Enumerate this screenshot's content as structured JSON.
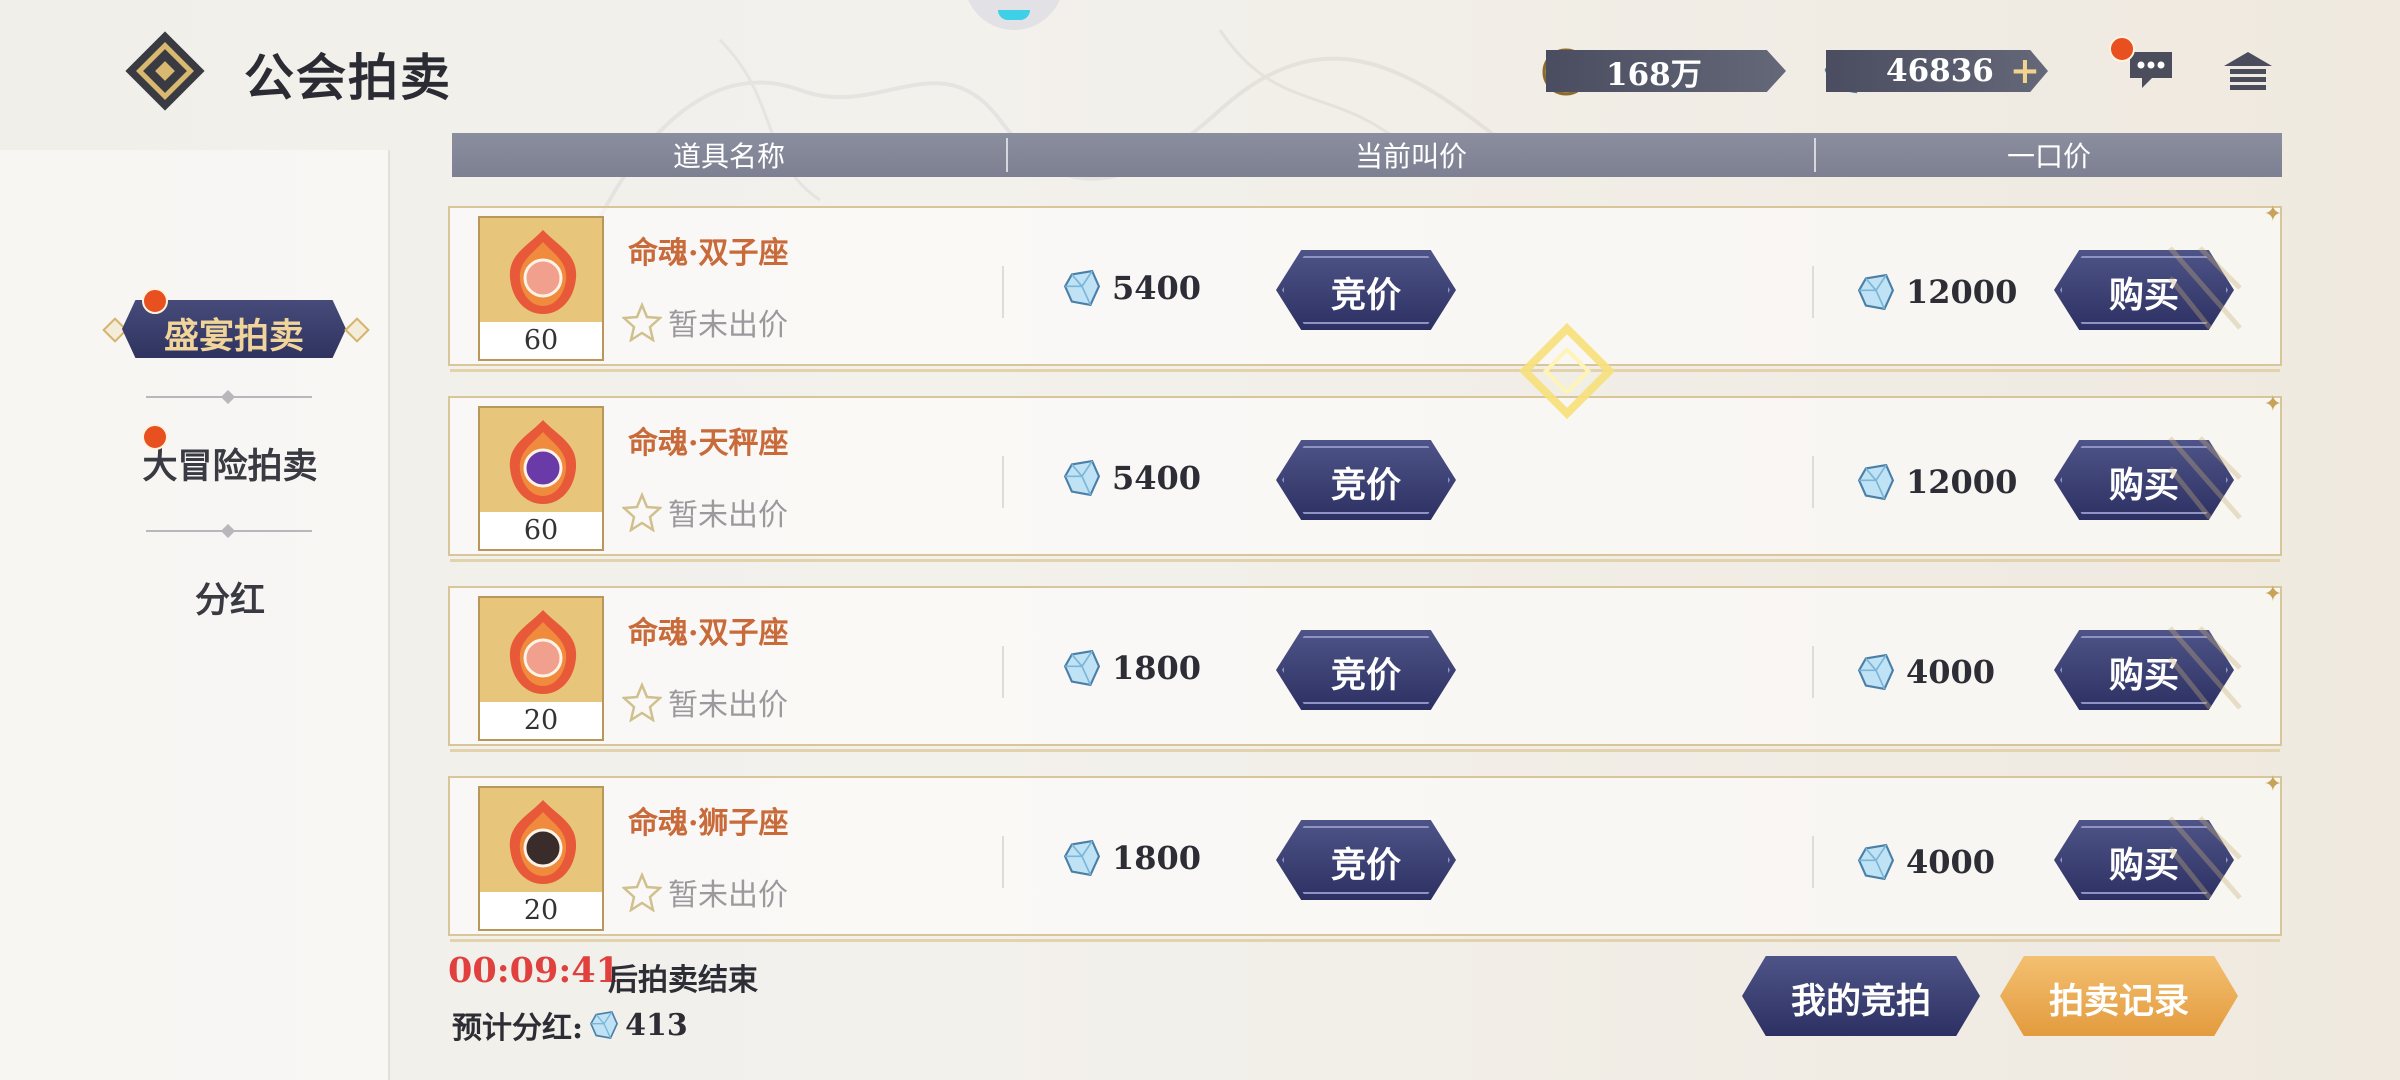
{
  "header": {
    "title": "公会拍卖",
    "gold": {
      "amount": "168万",
      "icon": "gold-coin-icon"
    },
    "crystal": {
      "amount": "46836",
      "plus": "+",
      "icon": "crystal-icon"
    },
    "chat_icon": "chat-icon",
    "home_icon": "home-icon"
  },
  "sidebar": {
    "items": [
      {
        "label": "盛宴拍卖",
        "active": true,
        "badge": true
      },
      {
        "label": "大冒险拍卖",
        "active": false,
        "badge": true
      },
      {
        "label": "分红",
        "active": false,
        "badge": false
      }
    ]
  },
  "table": {
    "headers": [
      "道具名称",
      "当前叫价",
      "一口价"
    ],
    "rows": [
      {
        "name": "命魂·双子座",
        "level": "60",
        "status": "暂未出价",
        "bid": "5400",
        "bid_button": "竞价",
        "buyout": "12000",
        "buy_button": "购买",
        "orb": "#f0a08c"
      },
      {
        "name": "命魂·天秤座",
        "level": "60",
        "status": "暂未出价",
        "bid": "5400",
        "bid_button": "竞价",
        "buyout": "12000",
        "buy_button": "购买",
        "orb": "#6a3aa8"
      },
      {
        "name": "命魂·双子座",
        "level": "20",
        "status": "暂未出价",
        "bid": "1800",
        "bid_button": "竞价",
        "buyout": "4000",
        "buy_button": "购买",
        "orb": "#f0a08c"
      },
      {
        "name": "命魂·狮子座",
        "level": "20",
        "status": "暂未出价",
        "bid": "1800",
        "bid_button": "竞价",
        "buyout": "4000",
        "buy_button": "购买",
        "orb": "#3a2c2a"
      }
    ]
  },
  "footer": {
    "timer": "00:09:41",
    "timer_label": "后拍卖结束",
    "dividend_label": "预计分红:",
    "dividend_value": "413",
    "my_bids_button": "我的竞拍",
    "records_button": "拍卖记录"
  },
  "colors": {
    "accent_navy": "#2f3360",
    "timer_red": "#e0413f",
    "item_name_orange": "#c86a3a",
    "records_orange": "#e8a54a"
  }
}
